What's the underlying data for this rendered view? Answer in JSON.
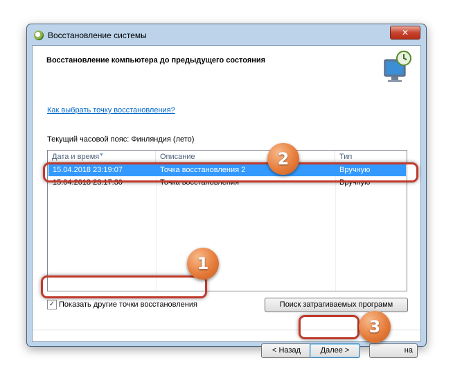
{
  "window": {
    "title": "Восстановление системы",
    "close_glyph": "✕",
    "header_title": "Восстановление компьютера до предыдущего состояния"
  },
  "body": {
    "help_link": "Как выбрать точку восстановления?",
    "timezone": "Текущий часовой пояс: Финляндия (лето)"
  },
  "table": {
    "columns": [
      "Дата и время",
      "Описание",
      "Тип"
    ],
    "rows": [
      {
        "date": "15.04.2018 23:19:07",
        "description": "Точка восстановления 2",
        "type": "Вручную",
        "selected": true
      },
      {
        "date": "15.04.2018 23:17:30",
        "description": "Точка восстановления",
        "type": "Вручную",
        "selected": false
      }
    ]
  },
  "show_more": {
    "label": "Показать другие точки восстановления",
    "checked": true
  },
  "buttons": {
    "scan": "Поиск затрагиваемых программ",
    "back": "< Назад",
    "next": "Далее >",
    "cancel_partial": "на"
  },
  "annotations": [
    "1",
    "2",
    "3"
  ],
  "colors": {
    "selection": "#3399ff",
    "highlight": "#c0392b",
    "badge": "#e67d3c",
    "link": "#0066cc"
  }
}
